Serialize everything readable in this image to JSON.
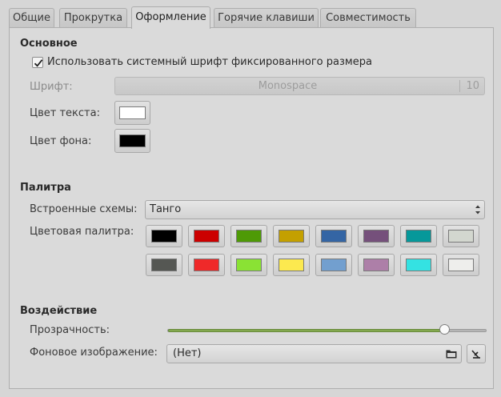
{
  "tabs": [
    {
      "label": "Общие",
      "active": false
    },
    {
      "label": "Прокрутка",
      "active": false
    },
    {
      "label": "Оформление",
      "active": true
    },
    {
      "label": "Горячие клавиши",
      "active": false
    },
    {
      "label": "Совместимость",
      "active": false
    }
  ],
  "basic": {
    "title": "Основное",
    "use_system_font_label": "Использовать системный шрифт фиксированного размера",
    "use_system_font_checked": true,
    "font_label": "Шрифт:",
    "font_name": "Monospace",
    "font_size": "10",
    "text_color_label": "Цвет текста:",
    "text_color": "#ffffff",
    "bg_color_label": "Цвет фона:",
    "bg_color": "#000000"
  },
  "palette": {
    "title": "Палитра",
    "schemes_label": "Встроенные схемы:",
    "scheme_value": "Танго",
    "colors_label": "Цветовая палитра:",
    "row1": [
      "#000000",
      "#cc0000",
      "#4e9a06",
      "#c4a000",
      "#3465a4",
      "#75507b",
      "#06989a",
      "#d3d7cf"
    ],
    "row2": [
      "#555753",
      "#ef2929",
      "#8ae234",
      "#fce94f",
      "#729fcf",
      "#ad7fa8",
      "#34e2e2",
      "#eeeeec"
    ]
  },
  "effects": {
    "title": "Воздействие",
    "transparency_label": "Прозрачность:",
    "transparency_value": 0.87,
    "bg_image_label": "Фоновое изображение:",
    "bg_image_value": "(Нет)"
  },
  "colors": {
    "accent": "#83a84f"
  }
}
